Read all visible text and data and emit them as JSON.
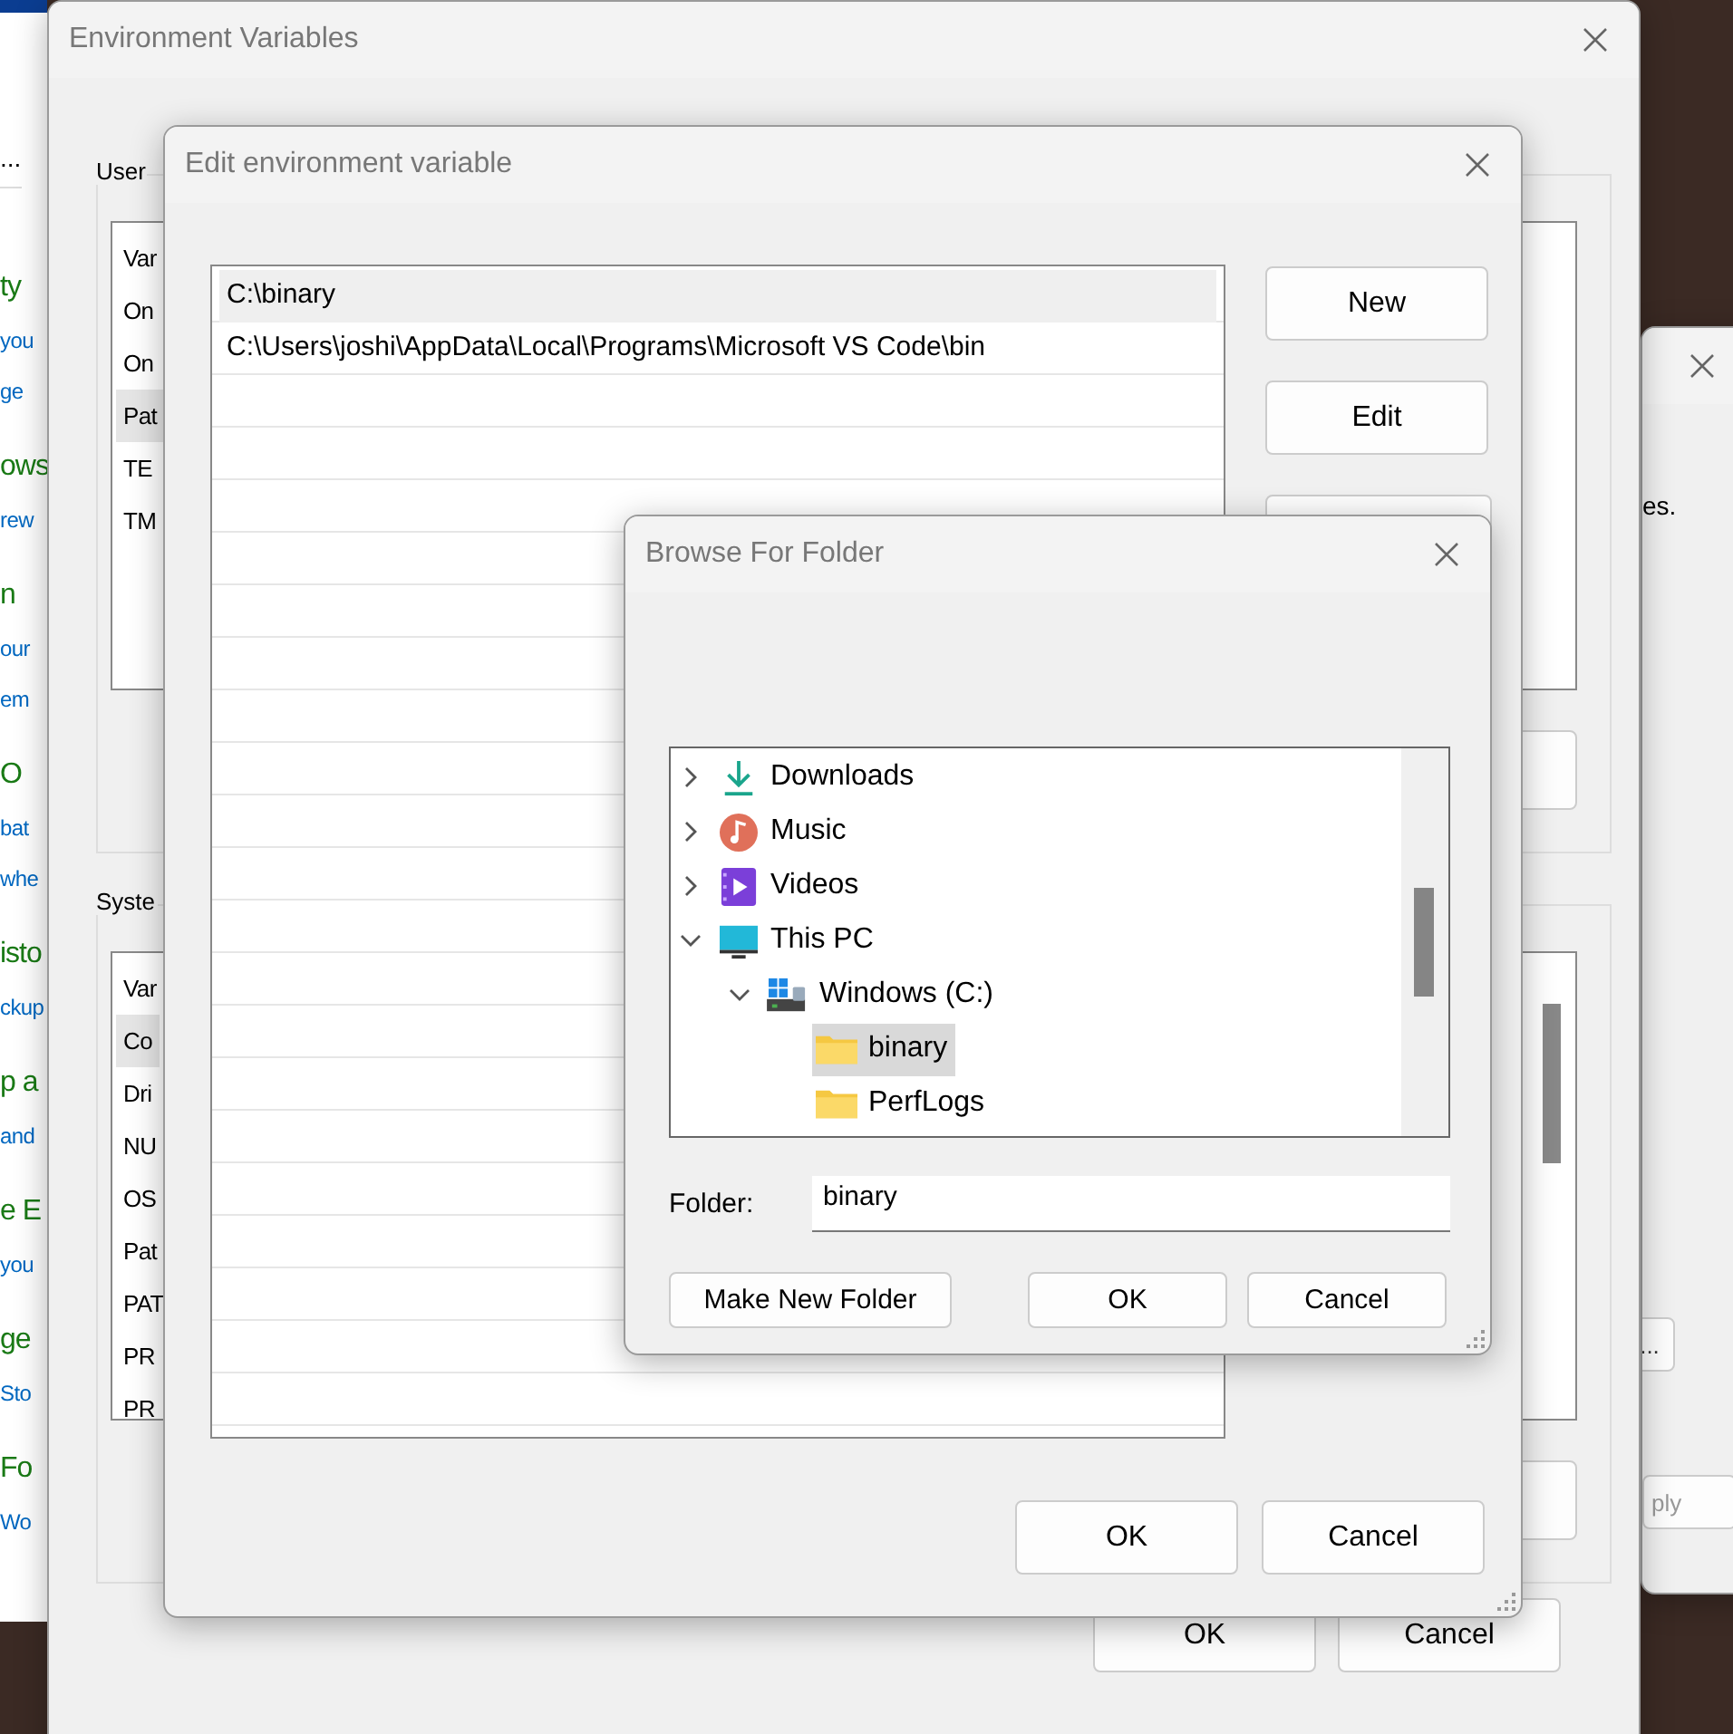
{
  "background_page": {
    "menu_text": "...",
    "items": [
      {
        "kind": "heading",
        "text": "ty"
      },
      {
        "kind": "link",
        "text": "you"
      },
      {
        "kind": "link",
        "text": "ge"
      },
      {
        "kind": "heading",
        "text": "ows"
      },
      {
        "kind": "link",
        "text": "rew"
      },
      {
        "kind": "heading",
        "text": "n"
      },
      {
        "kind": "link",
        "text": "our"
      },
      {
        "kind": "link",
        "text": "em"
      },
      {
        "kind": "heading",
        "text": "O"
      },
      {
        "kind": "link",
        "text": "bat"
      },
      {
        "kind": "link",
        "text": "whe"
      },
      {
        "kind": "heading",
        "text": "isto"
      },
      {
        "kind": "link",
        "text": "ckup"
      },
      {
        "kind": "heading",
        "text": "p a"
      },
      {
        "kind": "link",
        "text": "and"
      },
      {
        "kind": "heading",
        "text": "e E"
      },
      {
        "kind": "link",
        "text": "you"
      },
      {
        "kind": "heading",
        "text": "ge"
      },
      {
        "kind": "link",
        "text": "Sto"
      },
      {
        "kind": "heading",
        "text": "Fo"
      },
      {
        "kind": "link",
        "text": "Wo"
      }
    ]
  },
  "system_properties": {
    "text": "es.",
    "browse_button": "...",
    "apply_button": "ply"
  },
  "environment_variables": {
    "title": "Environment Variables",
    "groups": [
      {
        "label": "User",
        "column": "Var",
        "rows": [
          {
            "text": "On",
            "selected": false
          },
          {
            "text": "On",
            "selected": false
          },
          {
            "text": "Pat",
            "selected": true
          },
          {
            "text": "TE",
            "selected": false
          },
          {
            "text": "TM",
            "selected": false
          }
        ]
      },
      {
        "label": "Syste",
        "column": "Var",
        "rows": [
          {
            "text": "Co",
            "selected": true
          },
          {
            "text": "Dri",
            "selected": false
          },
          {
            "text": "NU",
            "selected": false
          },
          {
            "text": "OS",
            "selected": false
          },
          {
            "text": "Pat",
            "selected": false
          },
          {
            "text": "PAT",
            "selected": false
          },
          {
            "text": "PR",
            "selected": false
          },
          {
            "text": "PR",
            "selected": false
          }
        ]
      }
    ],
    "buttons": [
      "OK",
      "Cancel"
    ]
  },
  "edit_variable": {
    "title": "Edit environment variable",
    "entries": [
      {
        "text": "C:\\binary",
        "selected": true
      },
      {
        "text": "C:\\Users\\joshi\\AppData\\Local\\Programs\\Microsoft VS Code\\bin",
        "selected": false
      }
    ],
    "side_buttons": [
      "New",
      "Edit"
    ],
    "buttons": [
      "OK",
      "Cancel"
    ]
  },
  "browse_folder": {
    "title": "Browse For Folder",
    "tree": [
      {
        "label": "Downloads",
        "kind": "downloads",
        "expanded": false,
        "selected": false
      },
      {
        "label": "Music",
        "kind": "music",
        "expanded": false,
        "selected": false
      },
      {
        "label": "Videos",
        "kind": "videos",
        "expanded": false,
        "selected": false
      },
      {
        "label": "This PC",
        "kind": "pc",
        "expanded": true,
        "selected": false,
        "children": [
          {
            "label": "Windows (C:)",
            "kind": "drive",
            "expanded": true,
            "selected": false,
            "children": [
              {
                "label": "binary",
                "kind": "folder",
                "selected": true
              },
              {
                "label": "PerfLogs",
                "kind": "folder",
                "selected": false
              }
            ]
          }
        ]
      }
    ],
    "folder_label": "Folder:",
    "folder_value": "binary",
    "buttons": [
      "Make New Folder",
      "OK",
      "Cancel"
    ]
  }
}
